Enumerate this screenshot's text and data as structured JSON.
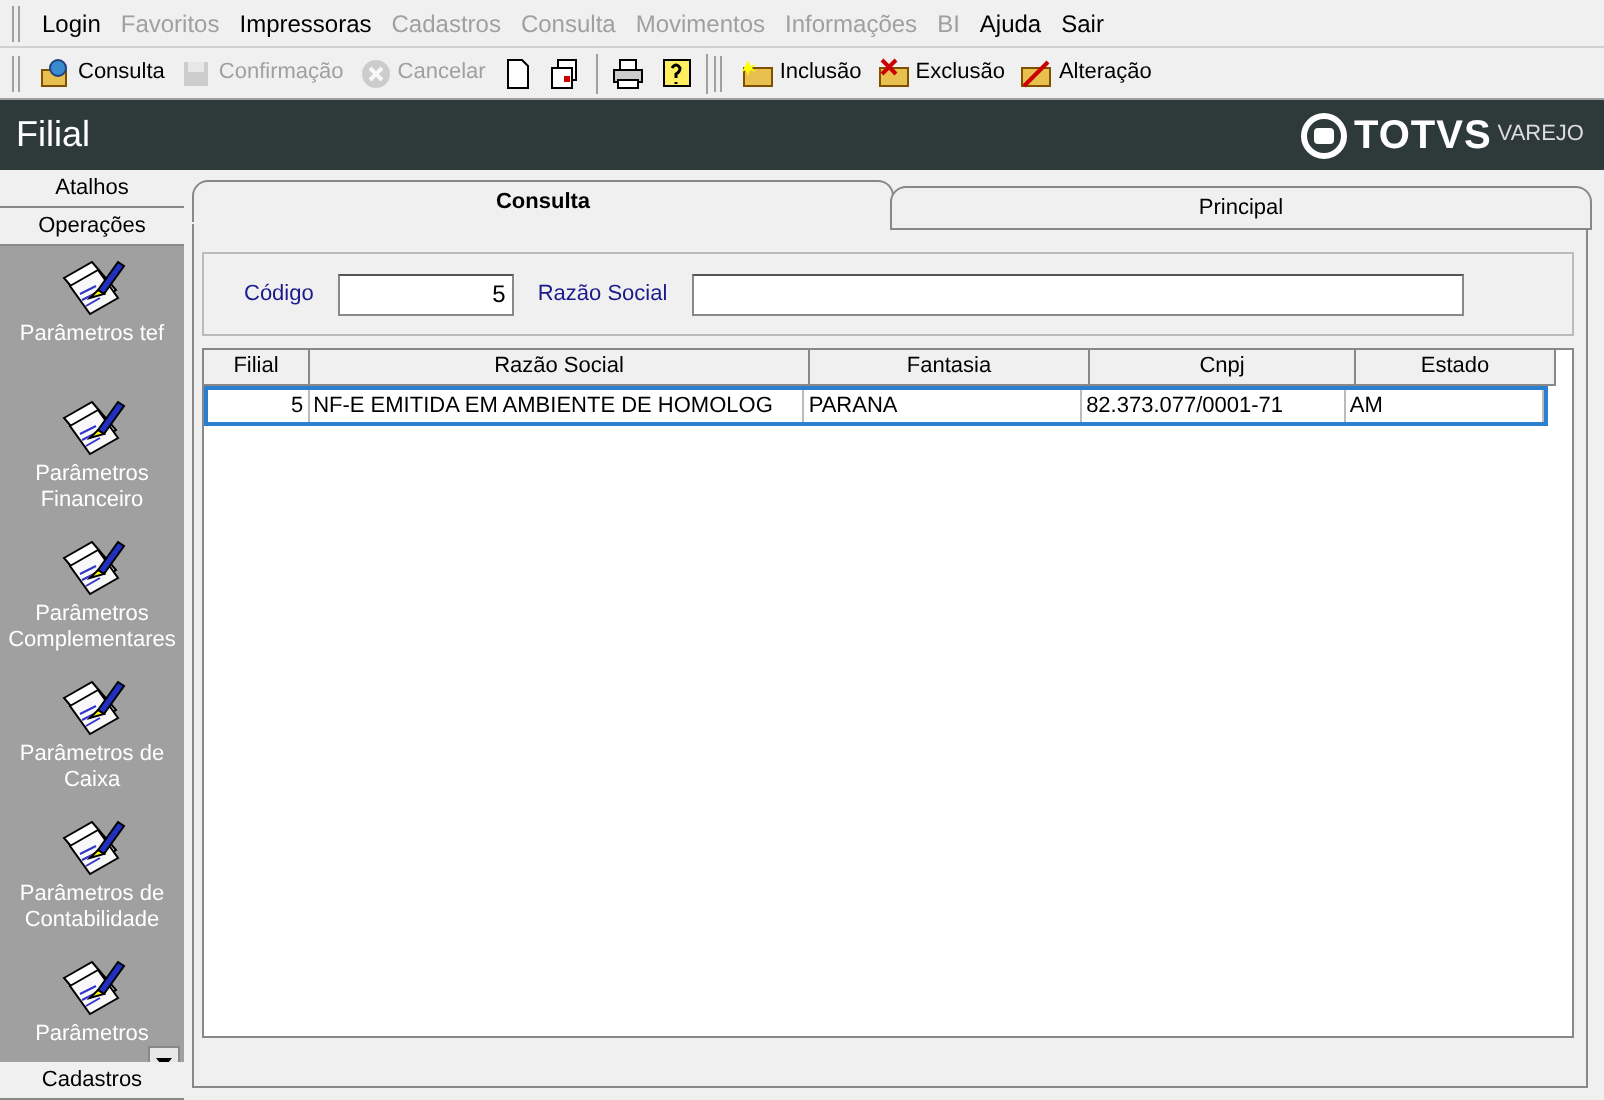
{
  "menu": [
    {
      "label": "Login",
      "disabled": false
    },
    {
      "label": "Favoritos",
      "disabled": true
    },
    {
      "label": "Impressoras",
      "disabled": false
    },
    {
      "label": "Cadastros",
      "disabled": true
    },
    {
      "label": "Consulta",
      "disabled": true
    },
    {
      "label": "Movimentos",
      "disabled": true
    },
    {
      "label": "Informações",
      "disabled": true
    },
    {
      "label": "BI",
      "disabled": true
    },
    {
      "label": "Ajuda",
      "disabled": false
    },
    {
      "label": "Sair",
      "disabled": false
    }
  ],
  "toolbar": [
    {
      "kind": "button",
      "label": "Consulta",
      "disabled": false
    },
    {
      "kind": "button",
      "label": "Confirmação",
      "disabled": true
    },
    {
      "kind": "button",
      "label": "Cancelar",
      "disabled": true
    },
    {
      "kind": "icon",
      "disabled": false
    },
    {
      "kind": "icon",
      "disabled": false
    },
    {
      "kind": "separator"
    },
    {
      "kind": "icon",
      "disabled": false
    },
    {
      "kind": "icon",
      "disabled": false
    },
    {
      "kind": "grip"
    },
    {
      "kind": "button",
      "label": "Inclusão",
      "disabled": false
    },
    {
      "kind": "button",
      "label": "Exclusão",
      "disabled": false
    },
    {
      "kind": "button",
      "label": "Alteração",
      "disabled": false
    }
  ],
  "window": {
    "title": "Filial",
    "brand": "TOTVS",
    "brand_sub": "VAREJO"
  },
  "sidebar": {
    "sections": [
      "Atalhos",
      "Operações"
    ],
    "items": [
      {
        "label": "Parâmetros tef"
      },
      {
        "label": "Parâmetros Financeiro"
      },
      {
        "label": "Parâmetros Complementares"
      },
      {
        "label": "Parâmetros de Caixa"
      },
      {
        "label": "Parâmetros de Contabilidade"
      },
      {
        "label": "Parâmetros"
      }
    ],
    "footer": "Cadastros"
  },
  "tabs": [
    {
      "label": "Consulta",
      "selected": true
    },
    {
      "label": "Principal",
      "selected": false
    }
  ],
  "filters": [
    {
      "label": "Código",
      "value": "5"
    },
    {
      "label": "Razão Social"
    }
  ],
  "table": {
    "columns": [
      {
        "label": "Filial"
      },
      {
        "label": "Razão Social"
      },
      {
        "label": "Fantasia"
      },
      {
        "label": "Cnpj"
      },
      {
        "label": "Estado"
      }
    ],
    "rows": [
      {
        "selected": true,
        "cells": [
          "5",
          "NF-E EMITIDA EM AMBIENTE DE HOMOLOG",
          "PARANA",
          "82.373.077/0001-71",
          "AM"
        ]
      }
    ]
  }
}
